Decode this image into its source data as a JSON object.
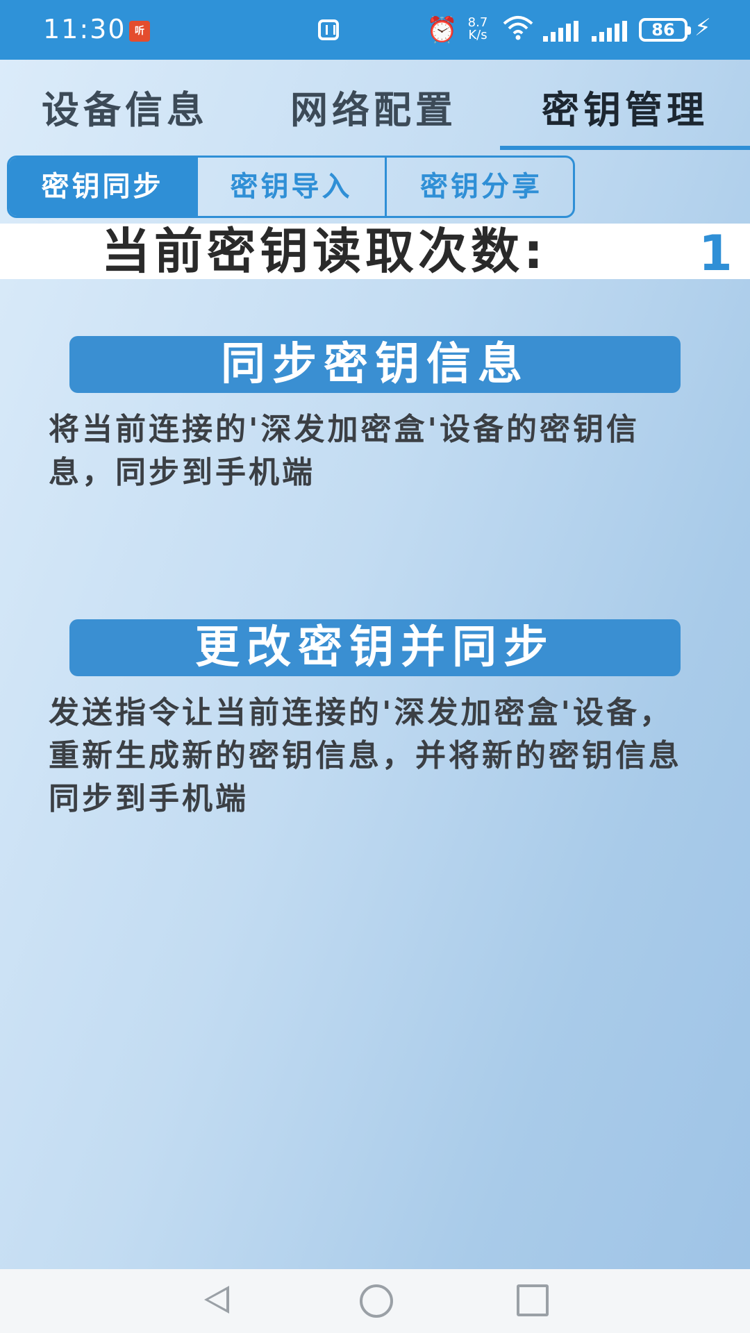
{
  "status_bar": {
    "time": "11:30",
    "app_icon_label": "听",
    "net_speed_value": "8.7",
    "net_speed_unit": "K/s",
    "battery": "86",
    "icons": [
      "nfc-icon",
      "alarm-icon",
      "wifi-icon",
      "signal-icon",
      "signal-icon",
      "battery-icon",
      "charging-icon"
    ]
  },
  "top_tabs": [
    {
      "label": "设备信息"
    },
    {
      "label": "网络配置"
    },
    {
      "label": "密钥管理"
    }
  ],
  "sub_tabs": [
    {
      "label": "密钥同步"
    },
    {
      "label": "密钥导入"
    },
    {
      "label": "密钥分享"
    }
  ],
  "counter": {
    "label": "当前密钥读取次数:",
    "value": "1"
  },
  "actions": [
    {
      "button": "同步密钥信息",
      "description": "将当前连接的'深发加密盒'设备的密钥信息，同步到手机端"
    },
    {
      "button": "更改密钥并同步",
      "description": "发送指令让当前连接的'深发加密盒'设备，重新生成新的密钥信息，并将新的密钥信息同步到手机端"
    }
  ],
  "colors": {
    "accent": "#2f8fd6",
    "status_bar": "#2f92d8",
    "button": "#3a8fd2"
  }
}
